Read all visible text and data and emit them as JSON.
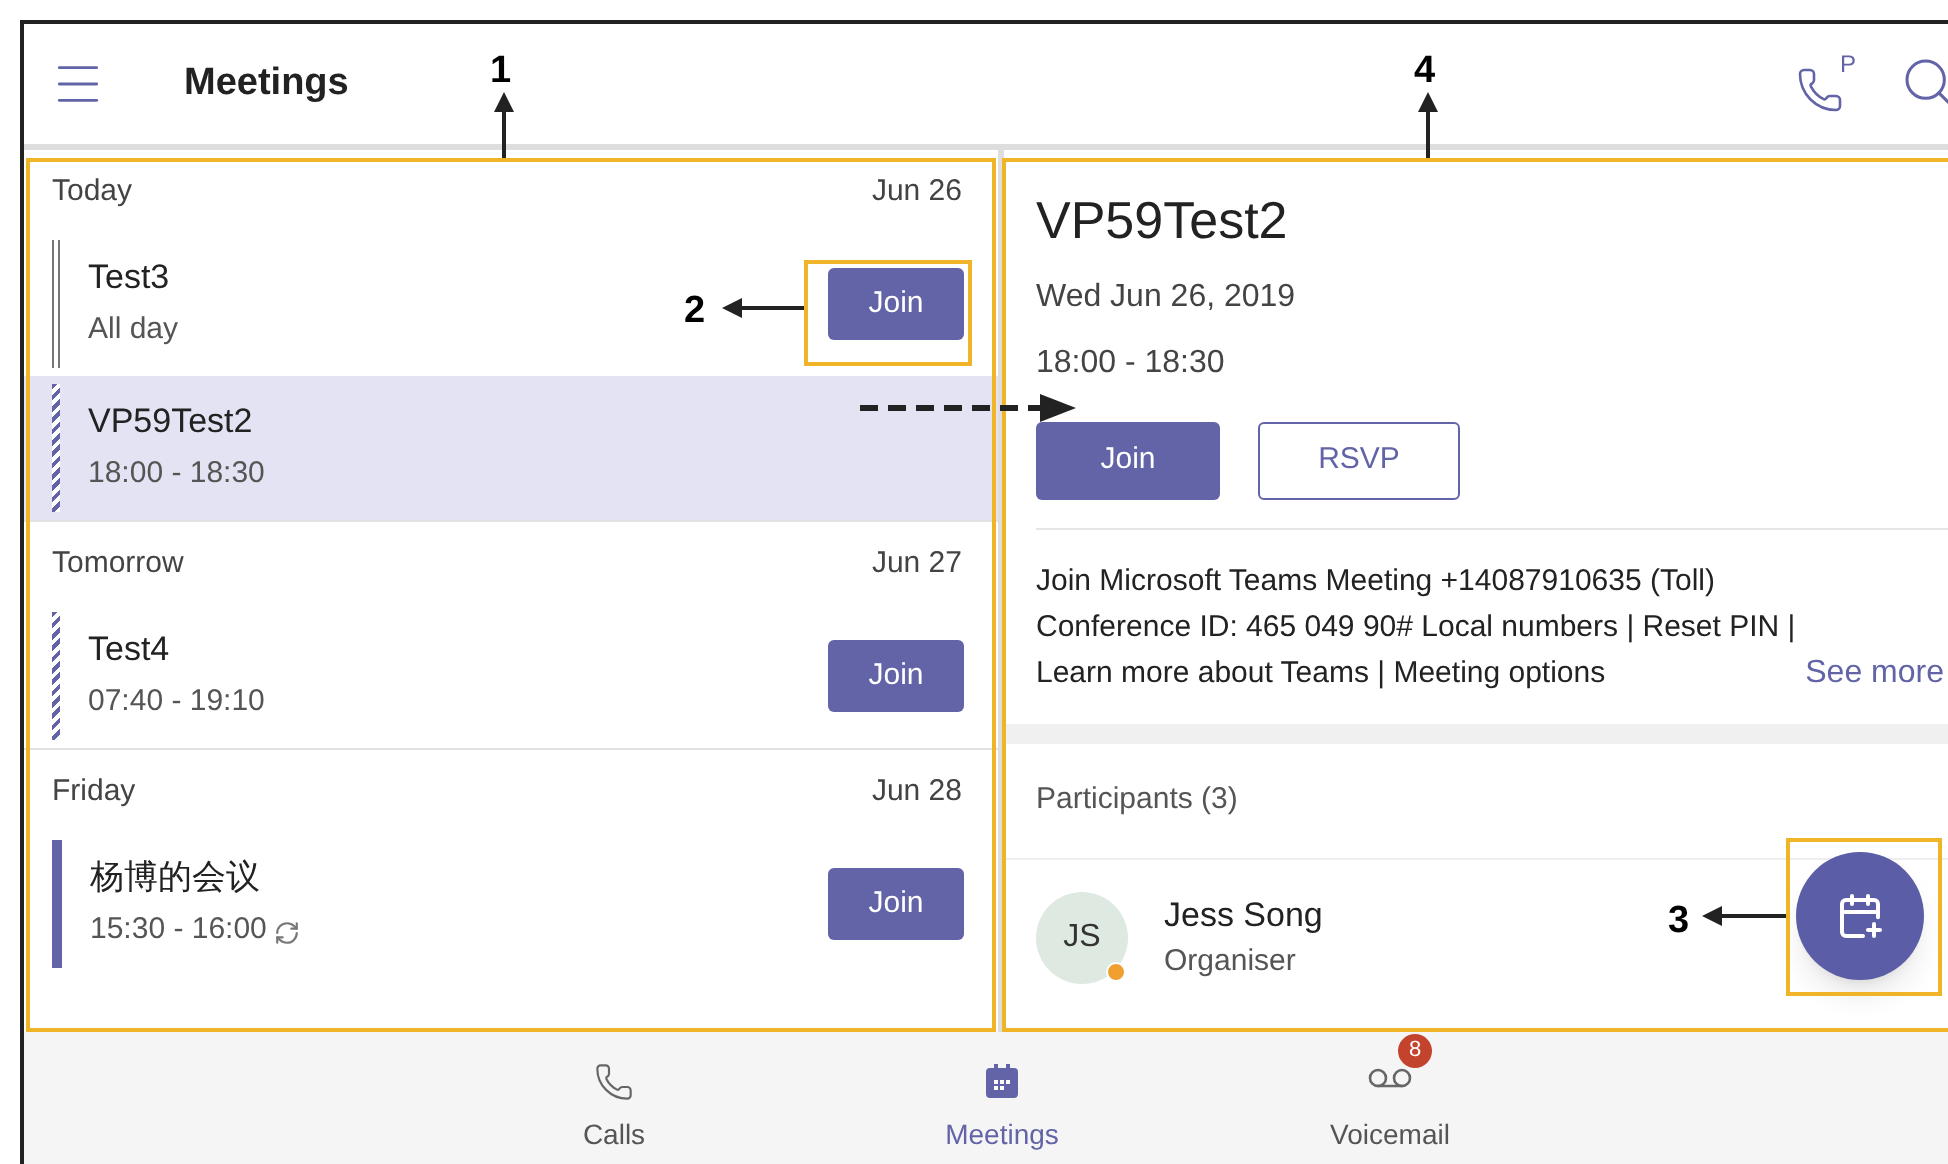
{
  "top_bar": {
    "title": "Meetings",
    "park_letter": "P"
  },
  "meetings_list": {
    "sections": [
      {
        "heading": "Today",
        "date": "Jun 26",
        "items": [
          {
            "title": "Test3",
            "time": "All day",
            "kind": "outline",
            "selected": false,
            "join": "Join",
            "recurring": false
          },
          {
            "title": "VP59Test2",
            "time": "18:00 - 18:30",
            "kind": "hatched",
            "selected": true,
            "recurring": false
          }
        ]
      },
      {
        "heading": "Tomorrow",
        "date": "Jun 27",
        "items": [
          {
            "title": "Test4",
            "time": "07:40 - 19:10",
            "kind": "hatched",
            "selected": false,
            "join": "Join",
            "recurring": false
          }
        ]
      },
      {
        "heading": "Friday",
        "date": "Jun 28",
        "items": [
          {
            "title": "杨博的会议",
            "time": "15:30 - 16:00",
            "kind": "solid",
            "selected": false,
            "join": "Join",
            "recurring": true
          }
        ]
      }
    ]
  },
  "details": {
    "title": "VP59Test2",
    "date": "Wed Jun 26, 2019",
    "time": "18:00 - 18:30",
    "join": "Join",
    "rsvp": "RSVP",
    "description_lines": [
      "Join Microsoft Teams Meeting +14087910635 (Toll)",
      "Conference ID: 465 049 90# Local numbers | Reset PIN |",
      "Learn more about Teams | Meeting options"
    ],
    "see_more": "See more",
    "participants_heading": "Participants (3)",
    "participants": [
      {
        "initials": "JS",
        "name": "Jess Song",
        "role": "Organiser",
        "color": "#f0a030"
      }
    ]
  },
  "bottom_nav": [
    {
      "label": "Calls",
      "kind": "phone",
      "selected": false
    },
    {
      "label": "Meetings",
      "kind": "calendar",
      "selected": true
    },
    {
      "label": "Voicemail",
      "kind": "voicemail",
      "selected": false,
      "badge": "8"
    }
  ],
  "annotations": [
    {
      "label": "1"
    },
    {
      "label": "2"
    },
    {
      "label": "3"
    },
    {
      "label": "4"
    }
  ]
}
